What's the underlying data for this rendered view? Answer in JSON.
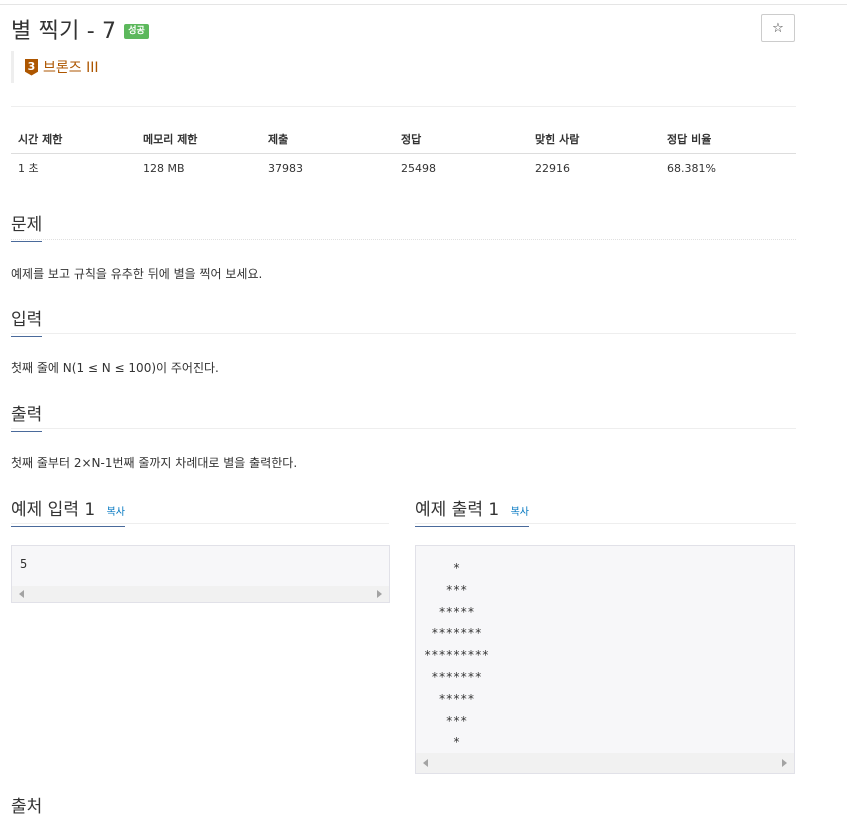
{
  "header": {
    "title": "별 찍기 - 7",
    "result_badge": "성공",
    "star_icon": "☆",
    "tier_number": "3",
    "tier_label": "브론즈 III",
    "tier_color": "#ad5600"
  },
  "info_table": {
    "headers": [
      "시간 제한",
      "메모리 제한",
      "제출",
      "정답",
      "맞힌 사람",
      "정답 비율"
    ],
    "values": [
      "1 초",
      "128 MB",
      "37983",
      "25498",
      "22916",
      "68.381%"
    ]
  },
  "sections": {
    "problem": {
      "title": "문제",
      "text": "예제를 보고 규칙을 유추한 뒤에 별을 찍어 보세요."
    },
    "input": {
      "title": "입력",
      "text": "첫째 줄에 N(1 ≤ N ≤ 100)이 주어진다."
    },
    "output": {
      "title": "출력",
      "text": "첫째 줄부터 2×N-1번째 줄까지 차례대로 별을 출력한다."
    }
  },
  "samples": {
    "input_title": "예제 입력 1",
    "output_title": "예제 출력 1",
    "copy_label": "복사",
    "input_text": "5",
    "output_text": "    *\n   ***\n  *****\n *******\n*********\n *******\n  *****\n   ***\n    *"
  },
  "footer": {
    "partial_heading": "출처"
  }
}
